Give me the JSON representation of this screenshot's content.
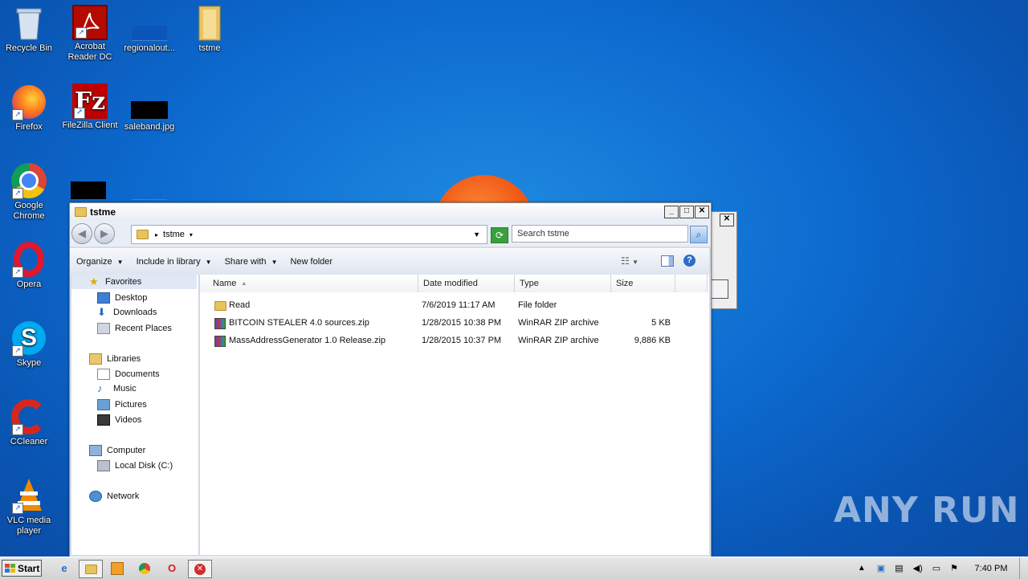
{
  "desktop": {
    "icons": [
      {
        "label": "Recycle Bin"
      },
      {
        "label": "Acrobat Reader DC"
      },
      {
        "label": "regionalout..."
      },
      {
        "label": "tstme"
      },
      {
        "label": "Firefox"
      },
      {
        "label": "FileZilla Client"
      },
      {
        "label": "saleband.jpg"
      },
      {
        "label": "Google Chrome"
      },
      {
        "label": "Opera"
      },
      {
        "label": "Skype"
      },
      {
        "label": "CCleaner"
      },
      {
        "label": "VLC media player"
      }
    ]
  },
  "window": {
    "title": "tstme",
    "address_path": "tstme",
    "search_placeholder": "Search tstme",
    "toolbar": {
      "organize": "Organize",
      "include_in_library": "Include in library",
      "share_with": "Share with",
      "new_folder": "New folder"
    },
    "nav": {
      "favorites": "Favorites",
      "desktop": "Desktop",
      "downloads": "Downloads",
      "recent_places": "Recent Places",
      "libraries": "Libraries",
      "documents": "Documents",
      "music": "Music",
      "pictures": "Pictures",
      "videos": "Videos",
      "computer": "Computer",
      "local_disk": "Local Disk (C:)",
      "network": "Network"
    },
    "columns": {
      "name": "Name",
      "date_modified": "Date modified",
      "type": "Type",
      "size": "Size"
    },
    "files": [
      {
        "name": "Read",
        "date": "7/6/2019 11:17 AM",
        "type": "File folder",
        "size": "",
        "icon": "folder-icon"
      },
      {
        "name": "BITCOIN STEALER 4.0 sources.zip",
        "date": "1/28/2015 10:38 PM",
        "type": "WinRAR ZIP archive",
        "size": "5 KB",
        "icon": "winrar-zip-icon"
      },
      {
        "name": "MassAddressGenerator 1.0 Release.zip",
        "date": "1/28/2015 10:37 PM",
        "type": "WinRAR ZIP archive",
        "size": "9,886 KB",
        "icon": "winrar-zip-icon"
      }
    ]
  },
  "taskbar": {
    "start_label": "Start",
    "clock": "7:40 PM"
  },
  "watermark": "ANY RUN"
}
